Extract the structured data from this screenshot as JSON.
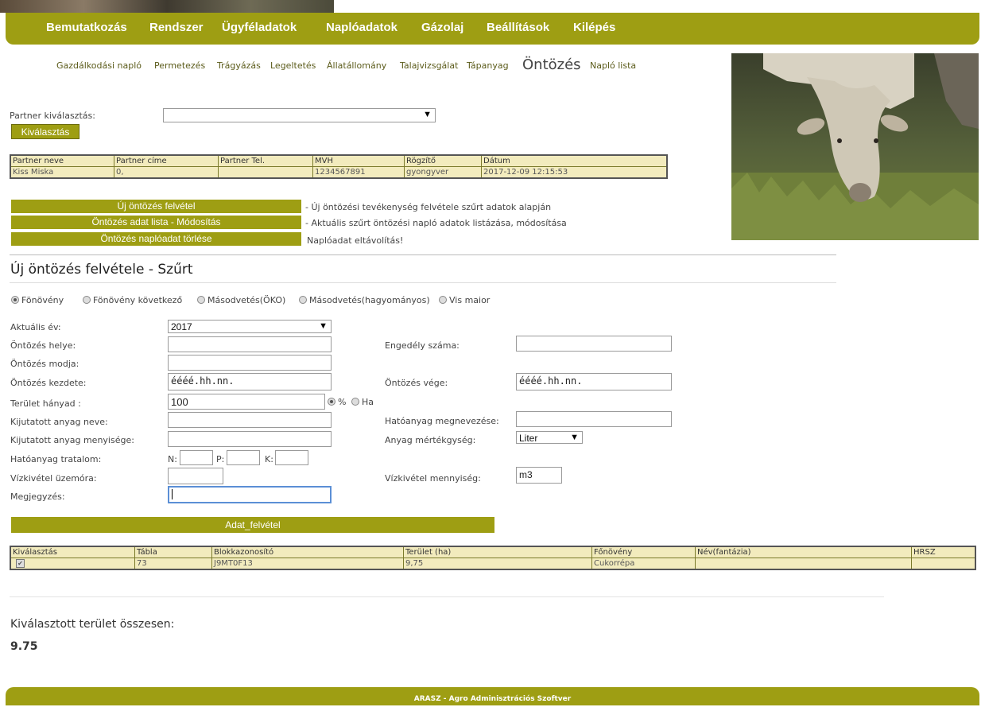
{
  "topnav": [
    "Bemutatkozás",
    "Rendszer",
    "Ügyféladatok",
    "Naplóadatok",
    "Gázolaj",
    "Beállítások",
    "Kilépés"
  ],
  "subnav": [
    "Gazdálkodási napló",
    "Permetezés",
    "Trágyázás",
    "Legeltetés",
    "Állatállomány",
    "Talajvizsgálat",
    "Tápanyag",
    "Öntözés",
    "Napló lista"
  ],
  "partner": {
    "label": "Partner kiválasztás:",
    "select_value": "",
    "button": "Kiválasztás"
  },
  "partner_table": {
    "headers": [
      "Partner neve",
      "Partner címe",
      "Partner Tel.",
      "MVH",
      "Rögzítő",
      "Dátum"
    ],
    "row": [
      "Kiss Miska",
      "0,",
      "",
      "1234567891",
      "gyongyver",
      "2017-12-09 12:15:53"
    ]
  },
  "actions": [
    {
      "button": "Új öntözés felvétel",
      "desc": "- Új öntözési tevékenység felvétele szűrt adatok alapján"
    },
    {
      "button": "Öntözés adat lista - Módosítás",
      "desc": "- Aktuális szűrt öntözési napló adatok listázása, módosítása"
    },
    {
      "button": "Öntözés naplóadat törlése",
      "desc": "Naplóadat eltávolítás!"
    }
  ],
  "section_title": "Új öntözés felvétele - Szűrt",
  "radios": [
    "Fönövény",
    "Fönövény következő",
    "Másodvetés(ÖKO)",
    "Másodvetés(hagyományos)",
    "Vis maior"
  ],
  "form": {
    "ev_label": "Aktuális év:",
    "ev_value": "2017",
    "helye_label": "Öntözés helye:",
    "modja_label": "Öntözés modja:",
    "kezdete_label": "Öntözés kezdete:",
    "kezdete_value": "éééé.hh.nn.",
    "terulet_label": "Terület hányad :",
    "terulet_value": "100",
    "unit_percent": "%",
    "unit_ha": "Ha",
    "anyag_neve_label": "Kijutatott anyag neve:",
    "anyag_mennyiseg_label": "Kijutatott anyag menyisége:",
    "hatoanyag_tartalom_label": "Hatóanyag tratalom:",
    "n_label": "N:",
    "p_label": "P:",
    "k_label": "K:",
    "uzemora_label": "Vízkivétel üzemóra:",
    "megjegyzes_label": "Megjegyzés:",
    "engedely_label": "Engedély száma:",
    "vege_label": "Öntözés vége:",
    "vege_value": "éééé.hh.nn.",
    "hatoanyag_nev_label": "Hatóanyag megnevezése:",
    "mertekegyseg_label": "Anyag mértékgység:",
    "mertekegyseg_value": "Liter",
    "vizkivetel_label": "Vízkivétel mennyiség:",
    "vizkivetel_value": "m3",
    "submit": "Adat_felvétel"
  },
  "parcel_table": {
    "headers": [
      "Kiválasztás",
      "Tábla",
      "Blokkazonosító",
      "Terület (ha)",
      "Főnövény",
      "Név(fantázia)",
      "HRSZ"
    ],
    "row": [
      "",
      "73",
      "J9MT0F13",
      "9,75",
      "Cukorrépa",
      "",
      ""
    ]
  },
  "summary": {
    "label": "Kiválasztott terület összesen:",
    "value": "9.75"
  },
  "footer": "ARASZ - Agro Adminisztrációs Szoftver",
  "colors": {
    "olive": "#9e9e13",
    "table_fill": "#f2ebbd"
  }
}
